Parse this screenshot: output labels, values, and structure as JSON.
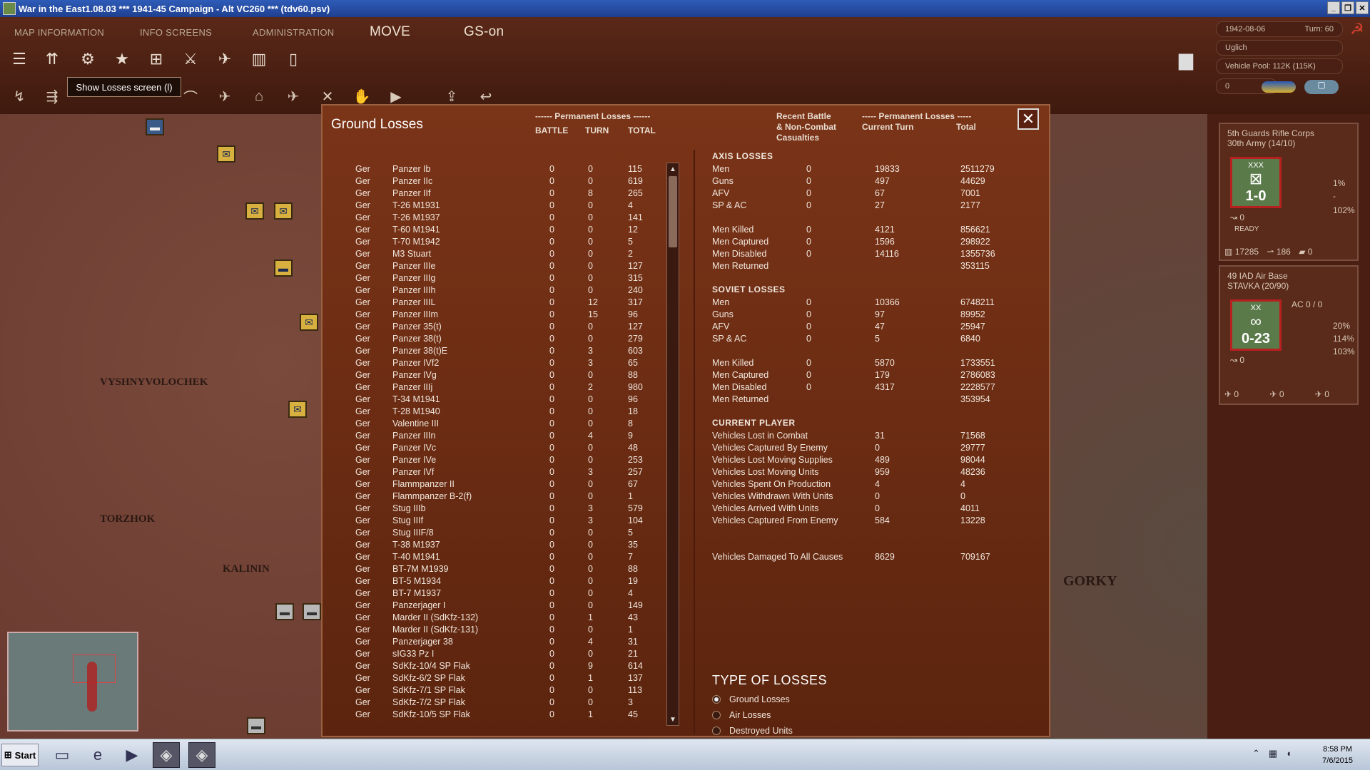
{
  "window": {
    "title": "War in the East1.08.03          ***   1941-45 Campaign - Alt VC260   ***   (tdv60.psv)"
  },
  "menu": {
    "map_information": "MAP INFORMATION",
    "info_screens": "INFO SCREENS",
    "administration": "ADMINISTRATION",
    "move": "MOVE",
    "gs_on": "GS-on"
  },
  "tooltip": "Show Losses screen (l)",
  "status": {
    "date": "1942-08-06",
    "turn": "Turn: 60",
    "location": "Uglich",
    "vehicle_pool": "Vehicle Pool: 112K (115K)",
    "field4": "0"
  },
  "map": {
    "labels": [
      "VYSHNYVOLOCHEK",
      "TORZHOK",
      "KALININ",
      "GORKY"
    ]
  },
  "unit1": {
    "name": "5th Guards Rifle Corps",
    "sub": "30th Army (14/10)",
    "size": "XXX",
    "value": "1-0",
    "ready": "READY",
    "pct1": "1%",
    "pct2": "-",
    "pct3": "102%",
    "mp": "0",
    "men": "17285",
    "guns": "186",
    "afv": "0"
  },
  "unit2": {
    "name": "49 IAD Air Base",
    "sub": "STAVKA (20/90)",
    "size": "XX",
    "value": "0-23",
    "ac": "AC 0 / 0",
    "pct1": "20%",
    "pct2": "114%",
    "pct3": "103%",
    "mp": "0",
    "a1": "0",
    "a2": "0",
    "a3": "0"
  },
  "dialog": {
    "title": "Ground Losses",
    "perm_header": "------ Permanent Losses ------",
    "col_battle": "BATTLE",
    "col_turn": "TURN",
    "col_total": "TOTAL",
    "recent_header_1": "Recent Battle",
    "recent_header_2": "& Non-Combat",
    "recent_header_3": "Casualties",
    "perm2_header": "----- Permanent Losses -----",
    "current_turn": "Current Turn",
    "total": "Total",
    "close": "✕"
  },
  "equipment": [
    [
      "Ger",
      "Panzer Ib",
      "0",
      "0",
      "115"
    ],
    [
      "Ger",
      "Panzer IIc",
      "0",
      "0",
      "619"
    ],
    [
      "Ger",
      "Panzer IIf",
      "0",
      "8",
      "265"
    ],
    [
      "Ger",
      "T-26 M1931",
      "0",
      "0",
      "4"
    ],
    [
      "Ger",
      "T-26 M1937",
      "0",
      "0",
      "141"
    ],
    [
      "Ger",
      "T-60 M1941",
      "0",
      "0",
      "12"
    ],
    [
      "Ger",
      "T-70 M1942",
      "0",
      "0",
      "5"
    ],
    [
      "Ger",
      "M3 Stuart",
      "0",
      "0",
      "2"
    ],
    [
      "Ger",
      "Panzer IIIe",
      "0",
      "0",
      "127"
    ],
    [
      "Ger",
      "Panzer IIIg",
      "0",
      "0",
      "315"
    ],
    [
      "Ger",
      "Panzer IIIh",
      "0",
      "0",
      "240"
    ],
    [
      "Ger",
      "Panzer IIIL",
      "0",
      "12",
      "317"
    ],
    [
      "Ger",
      "Panzer IIIm",
      "0",
      "15",
      "96"
    ],
    [
      "Ger",
      "Panzer 35(t)",
      "0",
      "0",
      "127"
    ],
    [
      "Ger",
      "Panzer 38(t)",
      "0",
      "0",
      "279"
    ],
    [
      "Ger",
      "Panzer 38(t)E",
      "0",
      "3",
      "603"
    ],
    [
      "Ger",
      "Panzer IVf2",
      "0",
      "3",
      "65"
    ],
    [
      "Ger",
      "Panzer IVg",
      "0",
      "0",
      "88"
    ],
    [
      "Ger",
      "Panzer IIIj",
      "0",
      "2",
      "980"
    ],
    [
      "Ger",
      "T-34 M1941",
      "0",
      "0",
      "96"
    ],
    [
      "Ger",
      "T-28 M1940",
      "0",
      "0",
      "18"
    ],
    [
      "Ger",
      "Valentine III",
      "0",
      "0",
      "8"
    ],
    [
      "Ger",
      "Panzer IIIn",
      "0",
      "4",
      "9"
    ],
    [
      "Ger",
      "Panzer IVc",
      "0",
      "0",
      "48"
    ],
    [
      "Ger",
      "Panzer IVe",
      "0",
      "0",
      "253"
    ],
    [
      "Ger",
      "Panzer IVf",
      "0",
      "3",
      "257"
    ],
    [
      "Ger",
      "Flammpanzer II",
      "0",
      "0",
      "67"
    ],
    [
      "Ger",
      "Flammpanzer B-2(f)",
      "0",
      "0",
      "1"
    ],
    [
      "Ger",
      "Stug IIIb",
      "0",
      "3",
      "579"
    ],
    [
      "Ger",
      "Stug IIIf",
      "0",
      "3",
      "104"
    ],
    [
      "Ger",
      "Stug IIIF/8",
      "0",
      "0",
      "5"
    ],
    [
      "Ger",
      "T-38 M1937",
      "0",
      "0",
      "35"
    ],
    [
      "Ger",
      "T-40 M1941",
      "0",
      "0",
      "7"
    ],
    [
      "Ger",
      "BT-7M M1939",
      "0",
      "0",
      "88"
    ],
    [
      "Ger",
      "BT-5 M1934",
      "0",
      "0",
      "19"
    ],
    [
      "Ger",
      "BT-7 M1937",
      "0",
      "0",
      "4"
    ],
    [
      "Ger",
      "Panzerjager I",
      "0",
      "0",
      "149"
    ],
    [
      "Ger",
      "Marder II (SdKfz-132)",
      "0",
      "1",
      "43"
    ],
    [
      "Ger",
      "Marder II (SdKfz-131)",
      "0",
      "0",
      "1"
    ],
    [
      "Ger",
      "Panzerjager 38",
      "0",
      "4",
      "31"
    ],
    [
      "Ger",
      "sIG33 Pz I",
      "0",
      "0",
      "21"
    ],
    [
      "Ger",
      "SdKfz-10/4 SP Flak",
      "0",
      "9",
      "614"
    ],
    [
      "Ger",
      "SdKfz-6/2 SP Flak",
      "0",
      "1",
      "137"
    ],
    [
      "Ger",
      "SdKfz-7/1 SP Flak",
      "0",
      "0",
      "113"
    ],
    [
      "Ger",
      "SdKfz-7/2 SP Flak",
      "0",
      "0",
      "3"
    ],
    [
      "Ger",
      "SdKfz-10/5 SP Flak",
      "0",
      "1",
      "45"
    ]
  ],
  "axis": {
    "title": "AXIS LOSSES",
    "rows": [
      [
        "Men",
        "0",
        "19833",
        "2511279"
      ],
      [
        "Guns",
        "0",
        "497",
        "44629"
      ],
      [
        "AFV",
        "0",
        "67",
        "7001"
      ],
      [
        "SP & AC",
        "0",
        "27",
        "2177"
      ]
    ],
    "rows2": [
      [
        "Men Killed",
        "0",
        "4121",
        "856621"
      ],
      [
        "Men Captured",
        "0",
        "1596",
        "298922"
      ],
      [
        "Men Disabled",
        "0",
        "14116",
        "1355736"
      ],
      [
        "Men Returned",
        "",
        "",
        "353115"
      ]
    ]
  },
  "soviet": {
    "title": "SOVIET LOSSES",
    "rows": [
      [
        "Men",
        "0",
        "10366",
        "6748211"
      ],
      [
        "Guns",
        "0",
        "97",
        "89952"
      ],
      [
        "AFV",
        "0",
        "47",
        "25947"
      ],
      [
        "SP & AC",
        "0",
        "5",
        "6840"
      ]
    ],
    "rows2": [
      [
        "Men Killed",
        "0",
        "5870",
        "1733551"
      ],
      [
        "Men Captured",
        "0",
        "179",
        "2786083"
      ],
      [
        "Men Disabled",
        "0",
        "4317",
        "2228577"
      ],
      [
        "Men Returned",
        "",
        "",
        "353954"
      ]
    ]
  },
  "current_player": {
    "title": "CURRENT PLAYER",
    "rows": [
      [
        "Vehicles Lost in Combat",
        "31",
        "71568"
      ],
      [
        "Vehicles Captured By Enemy",
        "0",
        "29777"
      ],
      [
        "Vehicles Lost Moving Supplies",
        "489",
        "98044"
      ],
      [
        "Vehicles Lost Moving Units",
        "959",
        "48236"
      ],
      [
        "Vehicles Spent On Production",
        "4",
        "4"
      ],
      [
        "Vehicles Withdrawn With Units",
        "0",
        "0"
      ],
      [
        "Vehicles Arrived With Units",
        "0",
        "4011"
      ],
      [
        "Vehicles Captured From Enemy",
        "584",
        "13228"
      ]
    ],
    "damaged": [
      "Vehicles Damaged To All Causes",
      "8629",
      "709167"
    ]
  },
  "type_of_losses": {
    "title": "TYPE OF LOSSES",
    "options": [
      "Ground Losses",
      "Air Losses",
      "Destroyed Units"
    ],
    "selected": 0
  },
  "taskbar": {
    "start": "Start",
    "time": "8:58 PM",
    "date": "7/6/2015"
  }
}
